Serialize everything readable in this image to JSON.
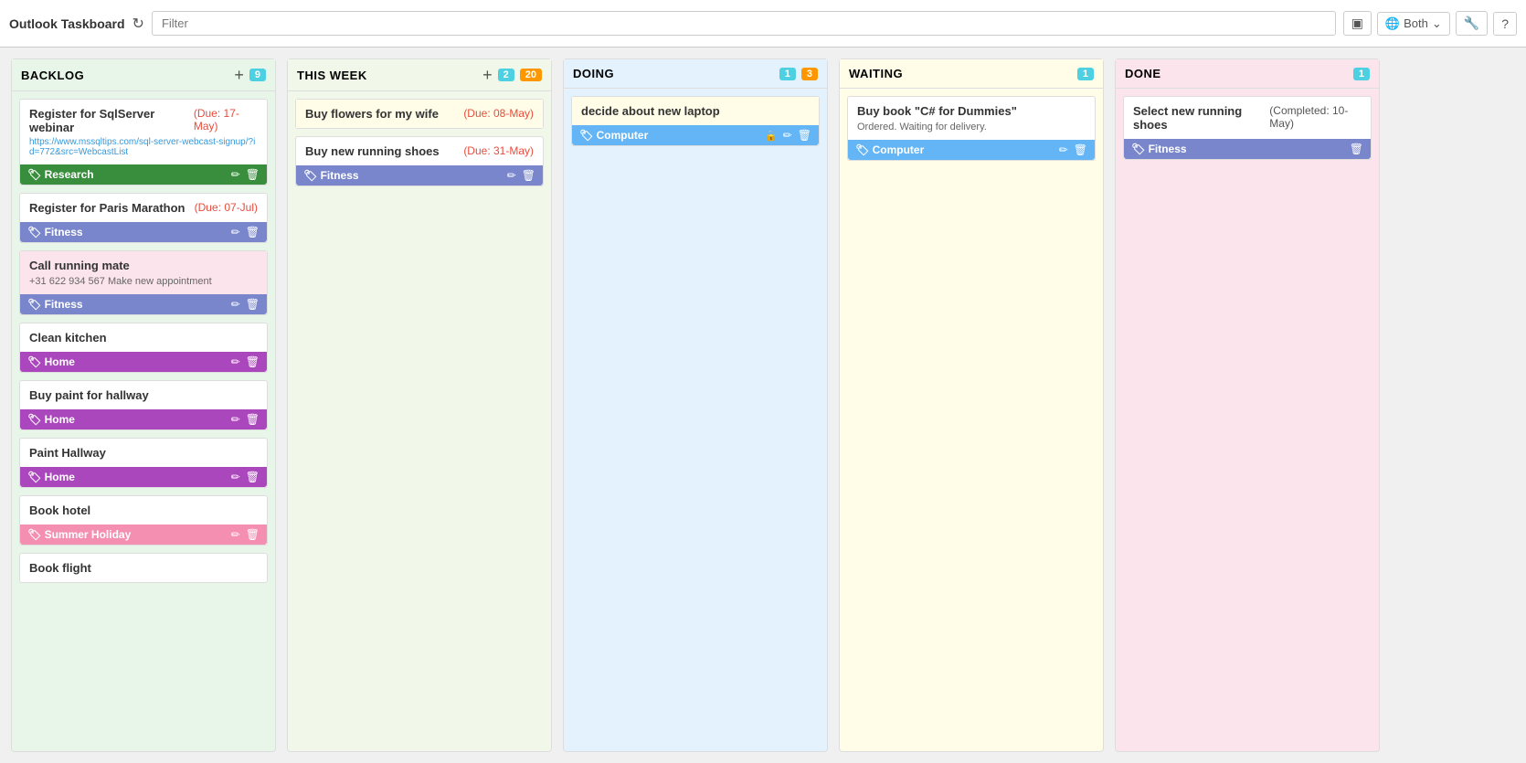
{
  "app": {
    "title": "Outlook Taskboard",
    "filter_placeholder": "Filter"
  },
  "header": {
    "both_label": "Both",
    "calendar_icon": "📅",
    "globe_icon": "🌐",
    "wrench_icon": "🔧",
    "help_icon": "?"
  },
  "columns": [
    {
      "id": "backlog",
      "title": "BACKLOG",
      "badge_count": "9",
      "badge_color": "cyan",
      "show_add": true,
      "cards": [
        {
          "title": "Register for SqlServer webinar",
          "due": "(Due: 17-May)",
          "link": "https://www.mssqltips.com/sql-server-webcast-signup/?id=772&src=WebcastList",
          "tag": "Research",
          "tag_class": "tag-research",
          "has_edit": true,
          "has_delete": true
        },
        {
          "title": "Register for Paris Marathon",
          "due": "(Due: 07-Jul)",
          "link": "",
          "tag": "Fitness",
          "tag_class": "tag-fitness",
          "has_edit": true,
          "has_delete": true
        },
        {
          "title": "Call running mate",
          "body": "+31 622 934 567 Make new appointment",
          "due": "",
          "tag": "Fitness",
          "tag_class": "tag-fitness",
          "card_bg": "card-pink",
          "has_edit": true,
          "has_delete": true
        },
        {
          "title": "Clean kitchen",
          "due": "",
          "tag": "Home",
          "tag_class": "tag-home",
          "has_edit": true,
          "has_delete": true
        },
        {
          "title": "Buy paint for hallway",
          "due": "",
          "tag": "Home",
          "tag_class": "tag-home",
          "has_edit": true,
          "has_delete": true
        },
        {
          "title": "Paint Hallway",
          "due": "",
          "tag": "Home",
          "tag_class": "tag-home",
          "has_edit": true,
          "has_delete": true
        },
        {
          "title": "Book hotel",
          "due": "",
          "tag": "Summer Holiday",
          "tag_class": "tag-summer",
          "has_edit": true,
          "has_delete": true
        },
        {
          "title": "Book flight",
          "due": "",
          "tag": null
        }
      ]
    },
    {
      "id": "thisweek",
      "title": "THIS WEEK",
      "badge_count": "2",
      "badge_count2": "20",
      "badge_color": "cyan",
      "badge_color2": "orange",
      "show_add": true,
      "cards": [
        {
          "title": "Buy flowers for my wife",
          "due": "(Due: 08-May)",
          "tag": null,
          "card_bg": "card-yellow",
          "has_lock": true,
          "has_edit": true,
          "has_delete": true
        },
        {
          "title": "Buy new running shoes",
          "due": "(Due: 31-May)",
          "tag": "Fitness",
          "tag_class": "tag-fitness",
          "has_edit": true,
          "has_delete": true
        }
      ]
    },
    {
      "id": "doing",
      "title": "DOING",
      "badge_count": "1",
      "badge_count2": "3",
      "badge_color": "cyan",
      "badge_color2": "orange",
      "show_add": false,
      "cards": [
        {
          "title": "decide about new laptop",
          "due": "",
          "tag": "Computer",
          "tag_class": "tag-computer",
          "card_bg": "card-yellow",
          "has_lock": true,
          "has_edit": true,
          "has_delete": true
        }
      ]
    },
    {
      "id": "waiting",
      "title": "WAITING",
      "badge_count": "1",
      "badge_color": "cyan",
      "show_add": false,
      "cards": [
        {
          "title": "Buy book \"C# for Dummies\"",
          "due": "",
          "body": "Ordered. Waiting for delivery.",
          "tag": "Computer",
          "tag_class": "tag-computer",
          "has_edit": true,
          "has_delete": true
        }
      ]
    },
    {
      "id": "done",
      "title": "DONE",
      "badge_count": "1",
      "badge_color": "cyan",
      "show_add": false,
      "cards": [
        {
          "title": "Select new running shoes",
          "completed": "(Completed: 10-May)",
          "tag": "Fitness",
          "tag_class": "tag-fitness",
          "has_delete": true
        }
      ]
    }
  ]
}
